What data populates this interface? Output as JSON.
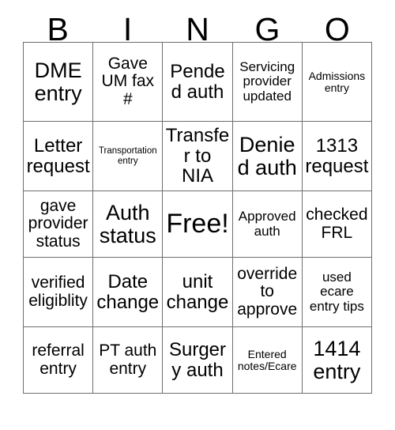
{
  "header": {
    "letters": [
      "B",
      "I",
      "N",
      "G",
      "O"
    ]
  },
  "grid": {
    "rows": 5,
    "columns": 5,
    "border_color": "#6e6e6e",
    "background_color": "#ffffff",
    "text_color": "#000000",
    "cells": [
      [
        {
          "text": "DME entry",
          "size": "xl"
        },
        {
          "text": "Gave UM fax #",
          "size": "md"
        },
        {
          "text": "Pended auth",
          "size": "lg"
        },
        {
          "text": "Servicing provider updated",
          "size": "sm"
        },
        {
          "text": "Admissions entry",
          "size": "xs"
        }
      ],
      [
        {
          "text": "Letter request",
          "size": "lg"
        },
        {
          "text": "Transportation entry",
          "size": "xxs"
        },
        {
          "text": "Transfer to NIA",
          "size": "lg"
        },
        {
          "text": "Denied auth",
          "size": "xl"
        },
        {
          "text": "1313 request",
          "size": "lg"
        }
      ],
      [
        {
          "text": "gave provider status",
          "size": "md"
        },
        {
          "text": "Auth status",
          "size": "xl"
        },
        {
          "text": "Free!",
          "size": "xxl"
        },
        {
          "text": "Approved auth",
          "size": "sm"
        },
        {
          "text": "checked FRL",
          "size": "md"
        }
      ],
      [
        {
          "text": "verified eligiblity",
          "size": "md"
        },
        {
          "text": "Date change",
          "size": "lg"
        },
        {
          "text": "unit change",
          "size": "lg"
        },
        {
          "text": "override to approve",
          "size": "md"
        },
        {
          "text": "used ecare entry tips",
          "size": "sm"
        }
      ],
      [
        {
          "text": "referral entry",
          "size": "md"
        },
        {
          "text": "PT auth entry",
          "size": "md"
        },
        {
          "text": "Surgery auth",
          "size": "lg"
        },
        {
          "text": "Entered notes/Ecare",
          "size": "xs"
        },
        {
          "text": "1414 entry",
          "size": "xl"
        }
      ]
    ]
  }
}
